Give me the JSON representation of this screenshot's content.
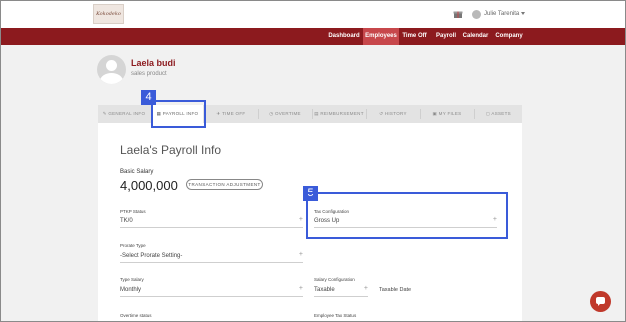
{
  "header": {
    "logo_text": "Kokodeko",
    "user_name": "Julie Tarenita"
  },
  "nav": {
    "items": [
      {
        "label": "Dashboard"
      },
      {
        "label": "Employees"
      },
      {
        "label": "Time Off"
      },
      {
        "label": "Payroll"
      },
      {
        "label": "Calendar"
      },
      {
        "label": "Company"
      }
    ],
    "active": "Employees"
  },
  "profile": {
    "name": "Laela budi",
    "role": "sales product"
  },
  "tabs": [
    {
      "label": "GENERAL INFO"
    },
    {
      "label": "PAYROLL INFO"
    },
    {
      "label": "TIME OFF"
    },
    {
      "label": "OVERTIME"
    },
    {
      "label": "REIMBURSEMENT"
    },
    {
      "label": "HISTORY"
    },
    {
      "label": "MY FILES"
    },
    {
      "label": "ASSETS"
    }
  ],
  "payroll": {
    "title": "Laela's Payroll Info",
    "basic_salary_label": "Basic Salary",
    "basic_salary_value": "4,000,000",
    "transaction_button": "TRANSACTION ADJUSTMENT",
    "ptkp_label": "PTKP Status",
    "ptkp_value": "TK/0",
    "tax_config_label": "Tax Configuration",
    "tax_config_value": "Gross Up",
    "prorate_label": "Prorate Type",
    "prorate_value": "-Select Prorate Setting-",
    "type_salary_label": "Type Salary",
    "type_salary_value": "Monthly",
    "salary_config_label": "Salary Configuration",
    "salary_config_value": "Taxable",
    "taxable_date_label": "Taxable Date",
    "overtime_label": "Overtime status",
    "employee_tax_label": "Employee Tax Status"
  },
  "annotations": {
    "step4": "4",
    "step5": "5"
  },
  "colors": {
    "brand": "#8c1a1e",
    "nav_active": "#c7474b",
    "annotation": "#3a5bd9"
  }
}
